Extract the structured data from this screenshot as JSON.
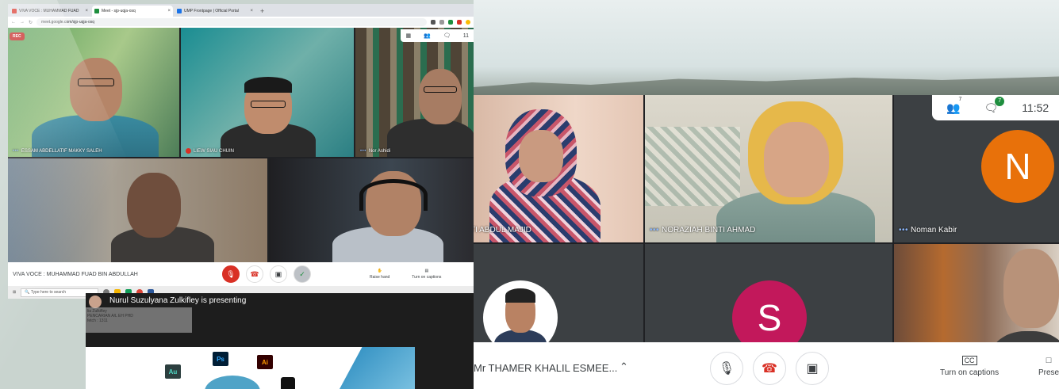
{
  "browser": {
    "tabs": [
      {
        "label": "VIVA VOCE : MUHAMMAD FUAD",
        "color": "#d93025",
        "active": false
      },
      {
        "label": "Meet - sjp-uqja-osq",
        "color": "#1e8e3e",
        "active": true
      },
      {
        "label": "UMP Frontpage | Official Portal",
        "color": "#1a73e8",
        "active": false
      }
    ],
    "url": "meet.google.com/sjp-uqja-osq",
    "rec_label": "REC",
    "participant_count": "11"
  },
  "left_meet": {
    "tiles": [
      {
        "name": "ESSAM ABDELLATIF MAKKY SALEH"
      },
      {
        "name": "LIEW SIAU CHUIN"
      },
      {
        "name": "Nor Ashidi"
      },
      {
        "name": ""
      },
      {
        "name": ""
      }
    ],
    "meeting_title": "VIVA VOCE : MUHAMMAD FUAD BIN ABDULLAH",
    "raise_hand": "Raise hand",
    "captions": "Turn on captions",
    "taskbar_search": "Type here to search"
  },
  "presentation": {
    "presenting_label": "Nurul Suzulyana Zulkifley is presenting",
    "inset_lines": [
      "lia Zulkifley",
      "PENCARIAN A/L EH PHD",
      "fetch : 1311"
    ],
    "apps": [
      "Au",
      "Ps",
      "Ai"
    ]
  },
  "right_meet": {
    "tiles": [
      {
        "name": "TI ABDUL MAJID"
      },
      {
        "name": "NORAZIAH BINTI AHMAD"
      },
      {
        "name": "Noman Kabir",
        "avatar": "N",
        "avatar_color": "#e8710a"
      },
      {
        "name": ""
      },
      {
        "name": "",
        "avatar": "S",
        "avatar_color": "#c2185b"
      },
      {
        "name": ""
      }
    ],
    "people_count": "7",
    "chat_count": "7",
    "clock": "11:52",
    "meeting_title": "Mr THAMER KHALIL ESMEE...",
    "captions": "Turn on captions",
    "present": "Prese"
  }
}
